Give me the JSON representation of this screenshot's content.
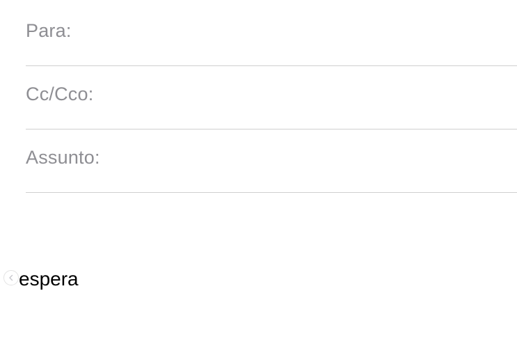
{
  "compose": {
    "to": {
      "label": "Para:",
      "value": ""
    },
    "cc_bcc": {
      "label": "Cc/Cco:",
      "value": ""
    },
    "subject": {
      "label": "Assunto:",
      "value": ""
    }
  },
  "body": {
    "text": "espera",
    "toggle_icon": "chevron-left-icon"
  }
}
